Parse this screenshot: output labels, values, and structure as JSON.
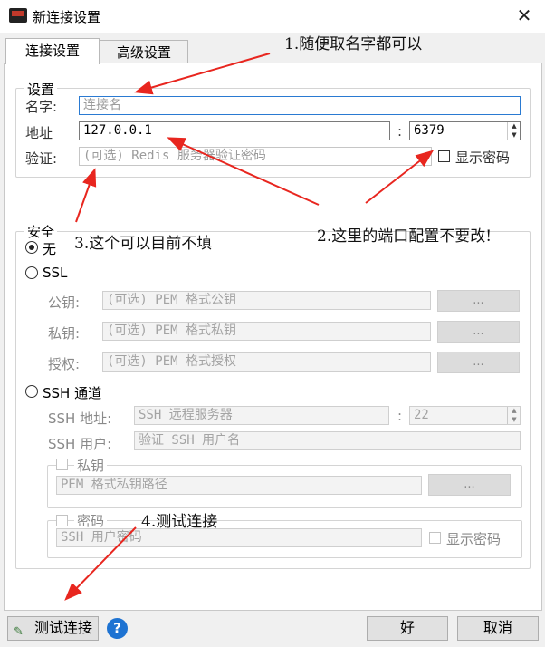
{
  "window": {
    "title": "新连接设置",
    "close_glyph": "✕"
  },
  "tabs": [
    {
      "label": "连接设置"
    },
    {
      "label": "高级设置"
    }
  ],
  "settings": {
    "legend": "设置",
    "name_label": "名字:",
    "name_placeholder": "连接名",
    "address_label": "地址",
    "address_value": "127.0.0.1",
    "port_colon": ":",
    "port_value": "6379",
    "auth_label": "验证:",
    "auth_placeholder": "(可选) Redis 服务器验证密码",
    "show_password_label": "显示密码"
  },
  "security": {
    "legend": "安全",
    "none_label": "无",
    "ssl_label": "SSL",
    "public_key_label": "公钥:",
    "public_key_placeholder": "(可选) PEM 格式公钥",
    "private_key_label": "私钥:",
    "private_key_placeholder": "(可选) PEM 格式私钥",
    "authority_label": "授权:",
    "authority_placeholder": "(可选) PEM 格式授权",
    "browse_label": "...",
    "ssh_label": "SSH 通道",
    "ssh_address_label": "SSH 地址:",
    "ssh_address_placeholder": "SSH 远程服务器",
    "ssh_port_value": "22",
    "ssh_user_label": "SSH 用户:",
    "ssh_user_placeholder": "验证 SSH 用户名",
    "ssh_private_key_label": "私钥",
    "ssh_private_key_placeholder": "PEM 格式私钥路径",
    "ssh_password_label": "密码",
    "ssh_password_placeholder": "SSH 用户密码",
    "ssh_show_password_label": "显示密码"
  },
  "buttons": {
    "test": "测试连接",
    "help": "?",
    "ok": "好",
    "cancel": "取消"
  },
  "annotations": {
    "a1": "1.随便取名字都可以",
    "a2": "2.这里的端口配置不要改!",
    "a3": "3.这个可以目前不填",
    "a4": "4.测试连接"
  },
  "colors": {
    "annotation_arrow": "#e8261f",
    "help_blue": "#1e73d2"
  }
}
